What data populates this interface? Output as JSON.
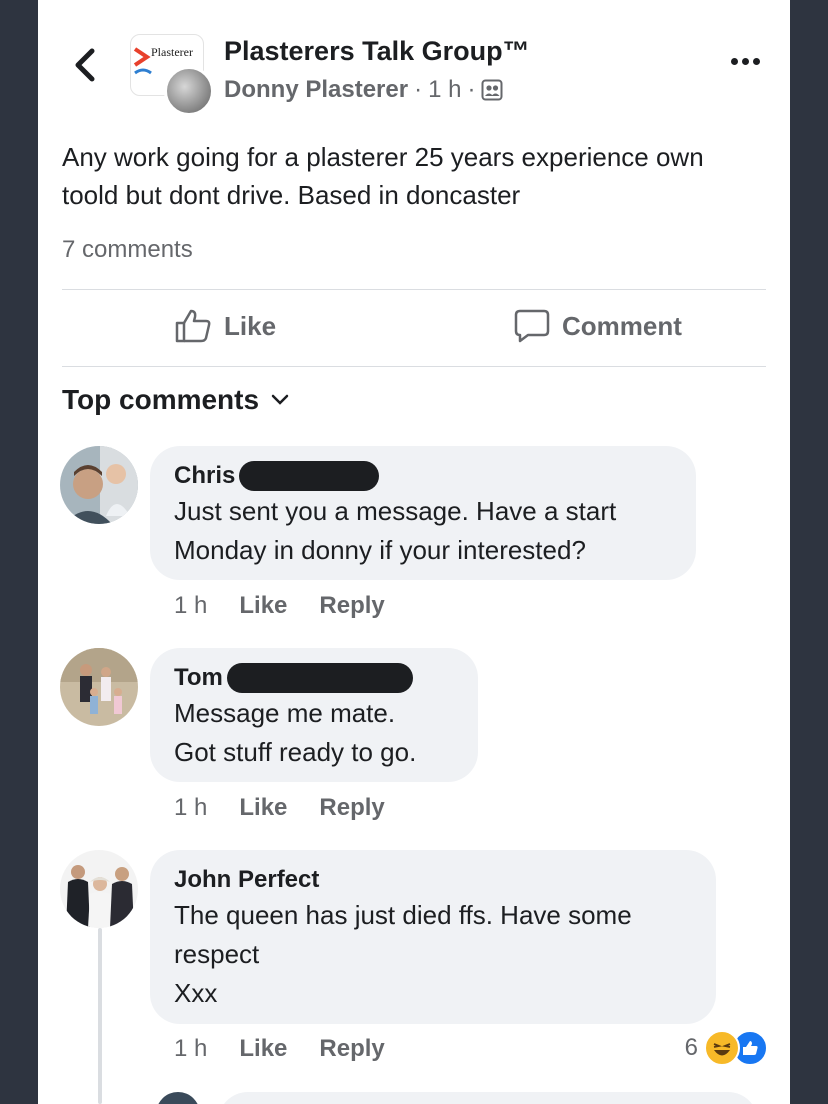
{
  "header": {
    "group_name": "Plasterers Talk Group™",
    "author": "Donny Plasterer",
    "time": "1 h",
    "separator": "·",
    "group_logo_text": "Plasterer"
  },
  "post": {
    "text": "Any work going for a plasterer 25 years experience own toold but dont drive. Based in doncaster",
    "comment_count": "7 comments"
  },
  "actions": {
    "like_label": "Like",
    "comment_label": "Comment"
  },
  "top_comments_label": "Top comments",
  "comments": [
    {
      "name": "Chris",
      "text": "Just sent you a message. Have a start Monday in donny if your interested?",
      "time": "1 h",
      "like": "Like",
      "reply": "Reply"
    },
    {
      "name": "Tom",
      "line1": "Message me mate.",
      "line2": "Got stuff ready to go.",
      "time": "1 h",
      "like": "Like",
      "reply": "Reply"
    },
    {
      "name": "John Perfect",
      "text": "The queen has just died ffs. Have some respect",
      "line2": "Xxx",
      "time": "1 h",
      "like": "Like",
      "reply": "Reply",
      "reaction_count": "6"
    }
  ],
  "colors": {
    "background": "#2e3440",
    "bubble": "#f0f2f5",
    "muted_text": "#65676b",
    "like_blue": "#1877f2",
    "haha_yellow": "#f7b928"
  },
  "icons": {
    "back": "chevron-left-icon",
    "more": "more-horizontal-icon",
    "audience": "group-members-icon",
    "like": "thumbs-up-icon",
    "comment": "speech-bubble-icon",
    "dropdown": "chevron-down-icon"
  }
}
